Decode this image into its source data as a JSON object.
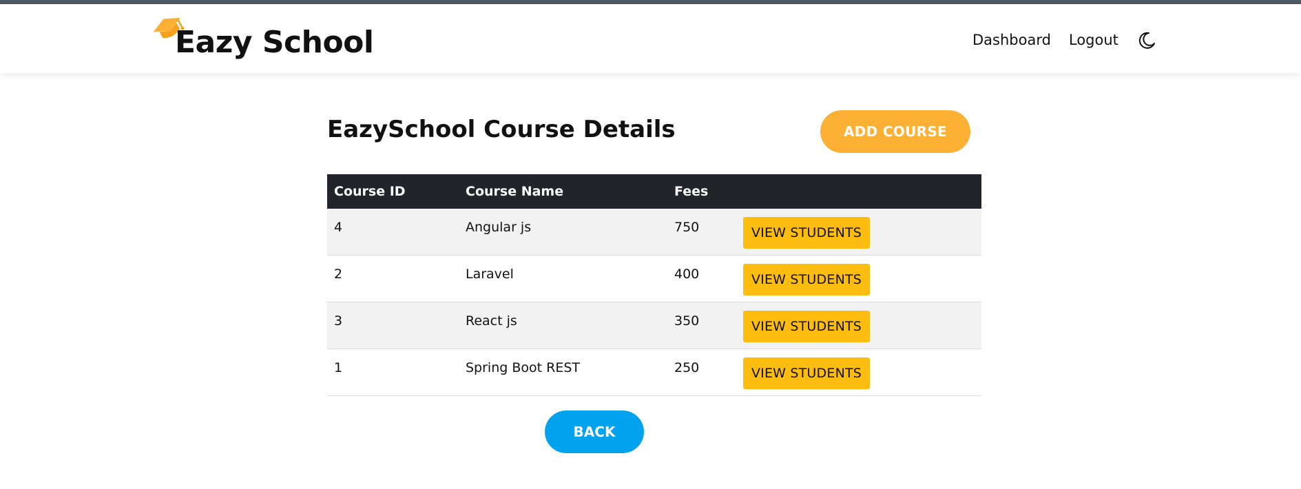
{
  "brand": {
    "name": "Eazy School",
    "icon": "graduation-cap-icon"
  },
  "nav": {
    "dashboard_label": "Dashboard",
    "logout_label": "Logout",
    "theme_icon": "moon-icon"
  },
  "page": {
    "title": "EazySchool Course Details",
    "add_course_label": "ADD COURSE",
    "back_label": "BACK"
  },
  "table": {
    "headers": [
      "Course ID",
      "Course Name",
      "Fees",
      ""
    ],
    "rows": [
      {
        "id": "4",
        "name": "Angular js",
        "fees": "750",
        "action": "VIEW STUDENTS"
      },
      {
        "id": "2",
        "name": "Laravel",
        "fees": "400",
        "action": "VIEW STUDENTS"
      },
      {
        "id": "3",
        "name": "React js",
        "fees": "350",
        "action": "VIEW STUDENTS"
      },
      {
        "id": "1",
        "name": "Spring Boot REST",
        "fees": "250",
        "action": "VIEW STUDENTS"
      }
    ]
  },
  "colors": {
    "accent_orange": "#fcb034",
    "button_yellow": "#fcbc10",
    "back_blue": "#02a2ee",
    "table_header": "#212529",
    "top_line": "#4b5a64"
  }
}
